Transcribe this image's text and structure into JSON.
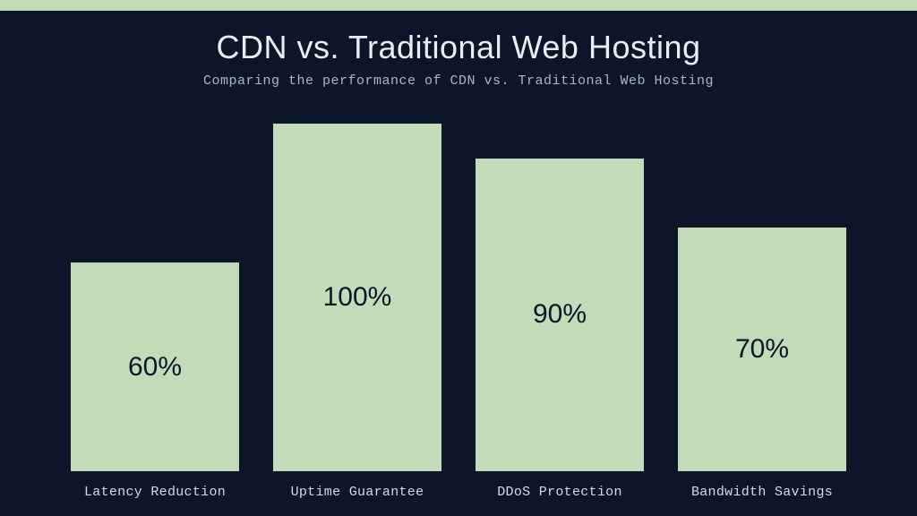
{
  "title": "CDN vs. Traditional Web Hosting",
  "subtitle": "Comparing the performance of CDN vs. Traditional Web Hosting",
  "chart_data": {
    "type": "bar",
    "categories": [
      "Latency Reduction",
      "Uptime Guarantee",
      "DDoS Protection",
      "Bandwidth Savings"
    ],
    "values": [
      60,
      100,
      90,
      70
    ],
    "data_labels": [
      "60%",
      "100%",
      "90%",
      "70%"
    ],
    "title": "CDN vs. Traditional Web Hosting",
    "xlabel": "",
    "ylabel": "",
    "ylim": [
      0,
      100
    ]
  },
  "bars": [
    {
      "label": "Latency Reduction",
      "value_label": "60%",
      "value": 60
    },
    {
      "label": "Uptime Guarantee",
      "value_label": "100%",
      "value": 100
    },
    {
      "label": "DDoS Protection",
      "value_label": "90%",
      "value": 90
    },
    {
      "label": "Bandwidth Savings",
      "value_label": "70%",
      "value": 70
    }
  ],
  "colors": {
    "background": "#0d1628",
    "bar_fill": "#c3dbb8",
    "accent_strip": "#c3dbb8",
    "title_text": "#e8eef2",
    "subtitle_text": "#a8b8c0"
  }
}
